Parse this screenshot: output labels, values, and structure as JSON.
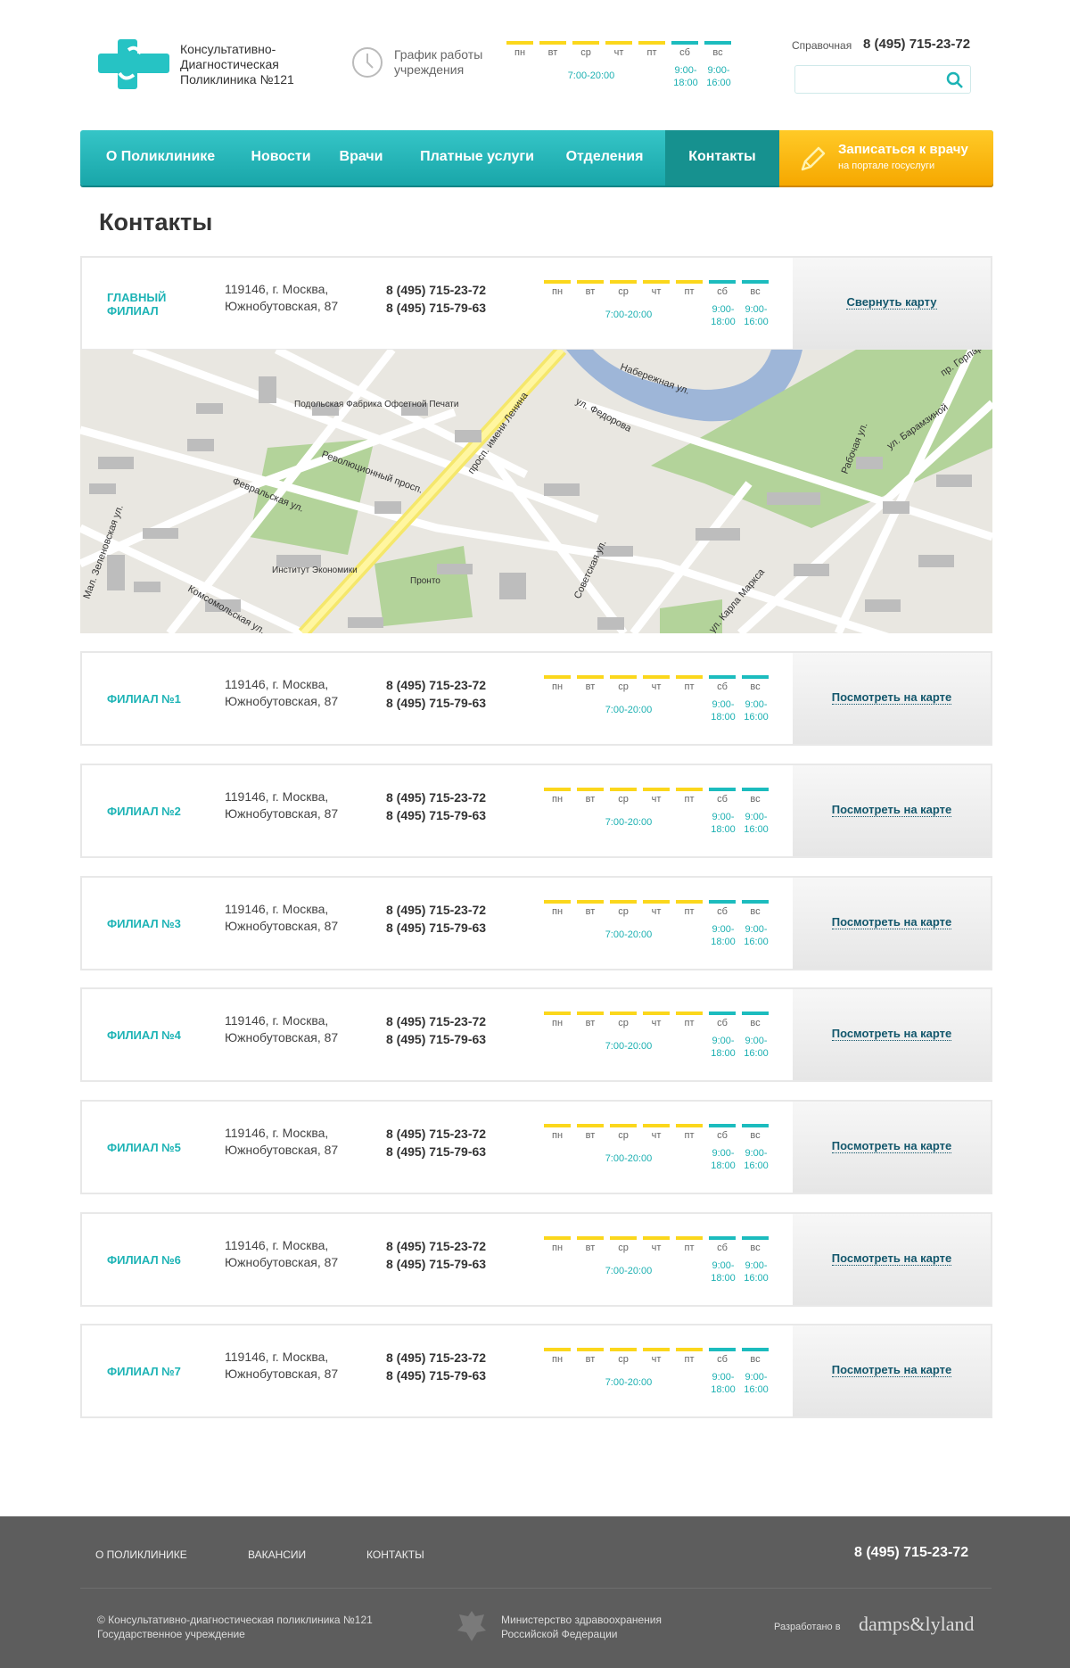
{
  "header": {
    "logo_text": "Консультативно-Диагностическая Поликлиника №121",
    "hours_label": "График работы учреждения",
    "days": [
      "пн",
      "вт",
      "ср",
      "чт",
      "пт",
      "сб",
      "вс"
    ],
    "weekday_hours": "7:00-20:00",
    "sat_hours": "9:00-18:00",
    "sun_hours": "9:00-16:00",
    "reference_label": "Справочная",
    "reference_phone": "8 (495) 715-23-72",
    "search_placeholder": ""
  },
  "nav": {
    "items": [
      "О Поликлинике",
      "Новости",
      "Врачи",
      "Платные услуги",
      "Отделения",
      "Контакты"
    ],
    "active": "Контакты",
    "enroll_title": "Записаться к врачу",
    "enroll_subtitle": "на портале госуслуги"
  },
  "page_title": "Контакты",
  "branches": [
    {
      "name": "Главный филиал",
      "address": "119146, г. Москва, Южнобутовская, 87",
      "phone1": "8 (495) 715-23-72",
      "phone2": "8 (495) 715-79-63",
      "link": "Свернуть карту"
    },
    {
      "name": "Филиал №1",
      "address": "119146, г. Москва, Южнобутовская, 87",
      "phone1": "8 (495) 715-23-72",
      "phone2": "8 (495) 715-79-63",
      "link": "Посмотреть на карте"
    },
    {
      "name": "Филиал №2",
      "address": "119146, г. Москва, Южнобутовская, 87",
      "phone1": "8 (495) 715-23-72",
      "phone2": "8 (495) 715-79-63",
      "link": "Посмотреть на карте"
    },
    {
      "name": "Филиал №3",
      "address": "119146, г. Москва, Южнобутовская, 87",
      "phone1": "8 (495) 715-23-72",
      "phone2": "8 (495) 715-79-63",
      "link": "Посмотреть на карте"
    },
    {
      "name": "Филиал №4",
      "address": "119146, г. Москва, Южнобутовская, 87",
      "phone1": "8 (495) 715-23-72",
      "phone2": "8 (495) 715-79-63",
      "link": "Посмотреть на карте"
    },
    {
      "name": "Филиал №5",
      "address": "119146, г. Москва, Южнобутовская, 87",
      "phone1": "8 (495) 715-23-72",
      "phone2": "8 (495) 715-79-63",
      "link": "Посмотреть на карте"
    },
    {
      "name": "Филиал №6",
      "address": "119146, г. Москва, Южнобутовская, 87",
      "phone1": "8 (495) 715-23-72",
      "phone2": "8 (495) 715-79-63",
      "link": "Посмотреть на карте"
    },
    {
      "name": "Филиал №7",
      "address": "119146, г. Москва, Южнобутовская, 87",
      "phone1": "8 (495) 715-23-72",
      "phone2": "8 (495) 715-79-63",
      "link": "Посмотреть на карте"
    }
  ],
  "map": {
    "street_labels": [
      "просп. имени Ленина",
      "Набережная ул.",
      "ул. Федорова",
      "ул. Барамзиной",
      "пр. Горпарка",
      "Рабочая ул.",
      "Революционный просп.",
      "Февральская ул.",
      "Комсомольская ул.",
      "Советская ул.",
      "ул. Карла Маркса",
      "Мал. Зеленовская ул.",
      "Подольская Фабрика Офсетной Печати",
      "Институт Экономики",
      "Пронто"
    ]
  },
  "footer": {
    "links": [
      "О поликлинике",
      "Вакансии",
      "Контакты"
    ],
    "phone": "8 (495) 715-23-72",
    "copyright": "© Консультативно-диагностическая поликлиника №121",
    "institution": "Государственное учреждение",
    "ministry_line1": "Министерство здравоохранения",
    "ministry_line2": "Российской Федерации",
    "developed_label": "Разработано в",
    "developer": "damps&lyland"
  },
  "colors": {
    "accent": "#1cbcbe",
    "yellow": "#fbd71c",
    "orange": "#f6a800",
    "footer": "#5d5d5d"
  }
}
